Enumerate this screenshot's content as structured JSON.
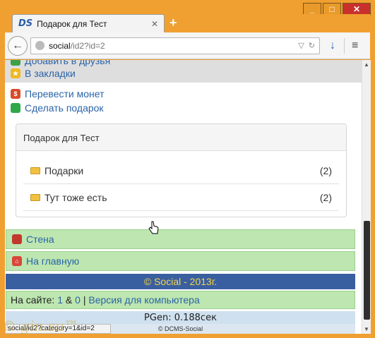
{
  "window": {
    "min": "_",
    "max": "□",
    "close": "✕"
  },
  "tab": {
    "logo": "DS",
    "title": "Подарок для Тест",
    "close": "✕",
    "new_tab": "+"
  },
  "toolbar": {
    "back": "←",
    "url_host": "social",
    "url_path": "/id2?id=2",
    "reload": "↻",
    "dropdown": "▽",
    "download": "↓",
    "menu": "≡"
  },
  "links": {
    "add_friend": "Добавить в друзья",
    "bookmarks": "В закладки",
    "transfer": "Перевести монет",
    "gift": "Сделать подарок"
  },
  "panel": {
    "title": "Подарок для Тест",
    "rows": [
      {
        "label": "Подарки",
        "count": "(2)"
      },
      {
        "label": "Тут тоже есть",
        "count": "(2)"
      }
    ]
  },
  "nav": {
    "wall": "Стена",
    "home": "На главную"
  },
  "footer": {
    "copyright": "© Social - 2013г.",
    "online_prefix": "На сайте:",
    "online_count1": "1",
    "online_amp": "&",
    "online_count2": "0",
    "online_sep": "|",
    "desktop_version": "Версия для компьютера",
    "pgen": "PGen: 0.188сек",
    "dcms": "© DCMS-Social"
  },
  "status_url": "social/id2?category=1&id=2",
  "watermark": "© gin.su™",
  "colors": {
    "accent_orange": "#f0a030",
    "link_blue": "#2a64a8",
    "green_row": "#bde6b0",
    "footer_blue": "#3a5fa0",
    "footer_text": "#f3d54a"
  }
}
